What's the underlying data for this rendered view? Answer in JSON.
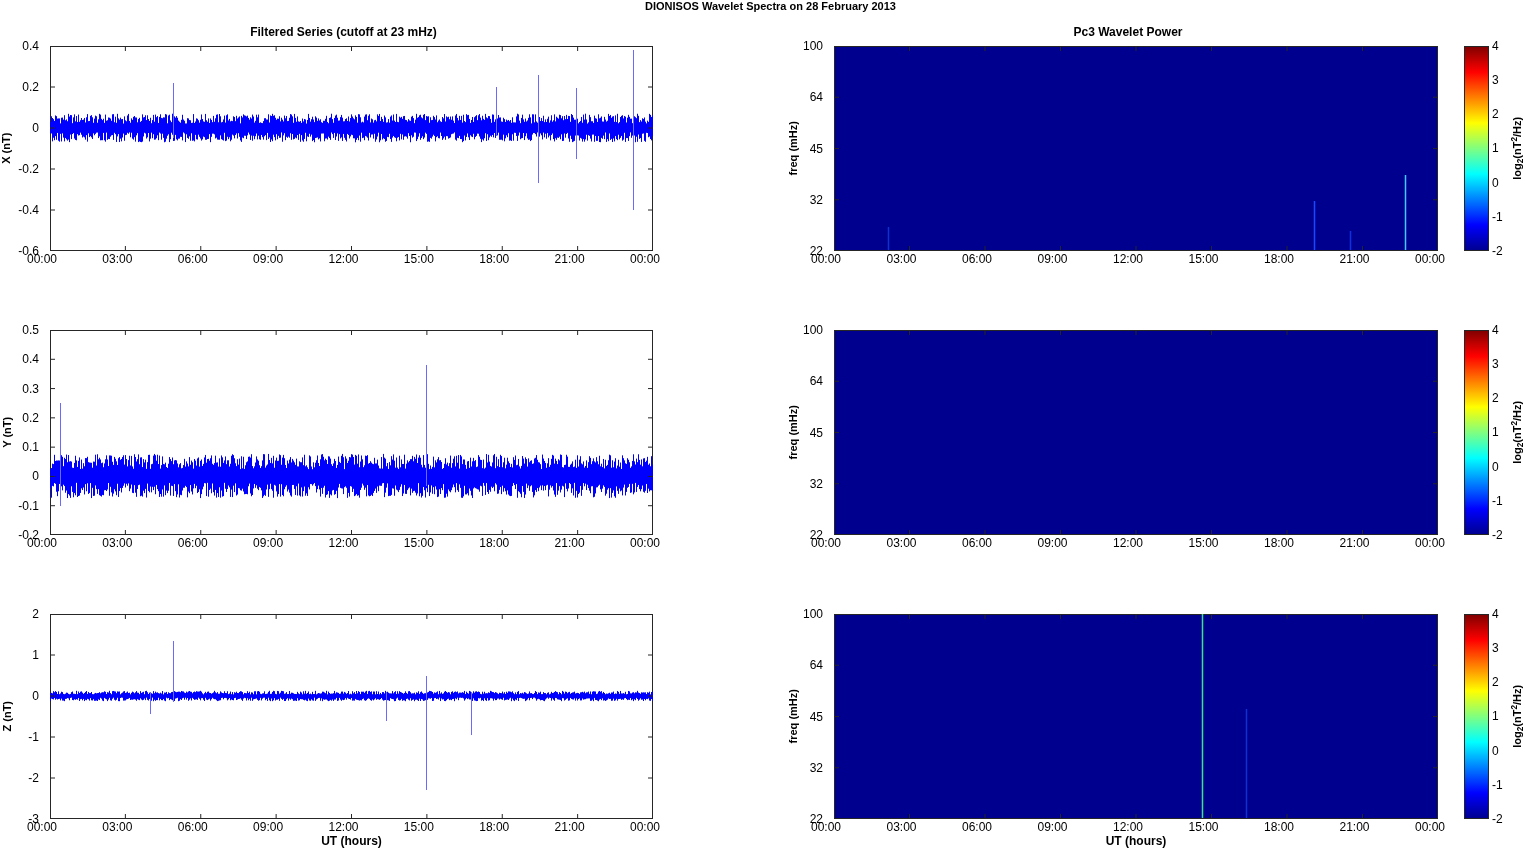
{
  "title": "DIONISOS Wavelet Spectra on 28 February  2013",
  "left_title": "Filtered Series (cutoff at 23 mHz)",
  "right_title": "Pc3 Wavelet Power",
  "rows": [
    {
      "series": {
        "ylabel": "X (nT)",
        "yticks": [
          "0.4",
          "0.2",
          "0",
          "-0.2",
          "-0.4",
          "-0.6"
        ],
        "xticks": [
          "00:00",
          "03:00",
          "06:00",
          "09:00",
          "12:00",
          "15:00",
          "18:00",
          "21:00",
          "00:00"
        ]
      },
      "spectrum": {
        "ylabel": "freq (mHz)",
        "yticks": [
          "100",
          "64",
          "45",
          "32",
          "22"
        ],
        "xticks": [
          "00:00",
          "03:00",
          "06:00",
          "09:00",
          "12:00",
          "15:00",
          "18:00",
          "21:00",
          "00:00"
        ],
        "colorbar": {
          "label": "log$_{2}$(nT$^{2}$/Hz)",
          "ticks": [
            "4",
            "3",
            "2",
            "1",
            "0",
            "-1",
            "-2"
          ]
        }
      }
    },
    {
      "series": {
        "ylabel": "Y (nT)",
        "yticks": [
          "0.5",
          "0.4",
          "0.3",
          "0.2",
          "0.1",
          "0",
          "-0.1",
          "-0.2"
        ],
        "xticks": [
          "00:00",
          "03:00",
          "06:00",
          "09:00",
          "12:00",
          "15:00",
          "18:00",
          "21:00",
          "00:00"
        ]
      },
      "spectrum": {
        "ylabel": "freq (mHz)",
        "yticks": [
          "100",
          "64",
          "45",
          "32",
          "22"
        ],
        "xticks": [
          "00:00",
          "03:00",
          "06:00",
          "09:00",
          "12:00",
          "15:00",
          "18:00",
          "21:00",
          "00:00"
        ],
        "colorbar": {
          "label": "log$_{2}$(nT$^{2}$/Hz)",
          "ticks": [
            "4",
            "3",
            "2",
            "1",
            "0",
            "-1",
            "-2"
          ]
        }
      }
    },
    {
      "series": {
        "ylabel": "Z (nT)",
        "yticks": [
          "2",
          "1",
          "0",
          "-1",
          "-2",
          "-3"
        ],
        "xticks": [
          "00:00",
          "03:00",
          "06:00",
          "09:00",
          "12:00",
          "15:00",
          "18:00",
          "21:00",
          "00:00"
        ],
        "xlabel": "UT (hours)"
      },
      "spectrum": {
        "ylabel": "freq (mHz)",
        "yticks": [
          "100",
          "64",
          "45",
          "32",
          "22"
        ],
        "xticks": [
          "00:00",
          "03:00",
          "06:00",
          "09:00",
          "12:00",
          "15:00",
          "18:00",
          "21:00",
          "00:00"
        ],
        "colorbar": {
          "label": "log$_{2}$(nT$^{2}$/Hz)",
          "ticks": [
            "4",
            "3",
            "2",
            "1",
            "0",
            "-1",
            "-2"
          ]
        },
        "xlabel": "UT (hours)"
      }
    }
  ]
}
